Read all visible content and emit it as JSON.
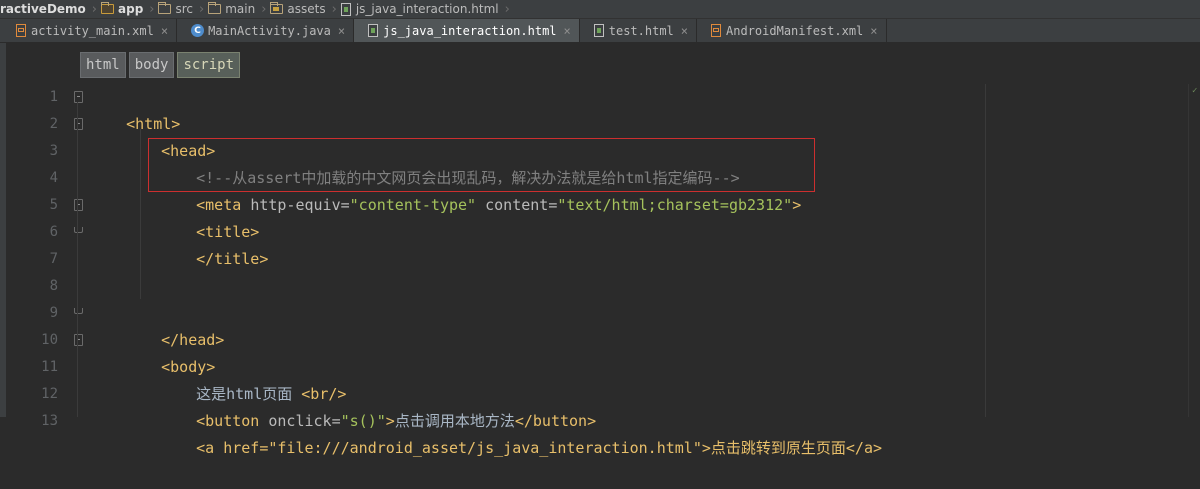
{
  "breadcrumbs": [
    {
      "label": "ractiveDemo",
      "icon": "module-folder-icon"
    },
    {
      "label": "app",
      "icon": "module-folder-icon"
    },
    {
      "label": "src",
      "icon": "folder-icon"
    },
    {
      "label": "main",
      "icon": "folder-icon"
    },
    {
      "label": "assets",
      "icon": "resources-folder-icon"
    },
    {
      "label": "js_java_interaction.html",
      "icon": "html-file-icon"
    }
  ],
  "tabs": [
    {
      "label": "activity_main.xml",
      "icon": "xml-file-icon",
      "active": false
    },
    {
      "label": "MainActivity.java",
      "icon": "java-class-icon",
      "active": false
    },
    {
      "label": "js_java_interaction.html",
      "icon": "html-file-icon",
      "active": true
    },
    {
      "label": "test.html",
      "icon": "html-file-icon",
      "active": false
    },
    {
      "label": "AndroidManifest.xml",
      "icon": "xml-file-icon",
      "active": false
    }
  ],
  "tab_close_glyph": "×",
  "tag_path": [
    "html",
    "body",
    "script"
  ],
  "editor": {
    "line_numbers": [
      "1",
      "2",
      "3",
      "4",
      "5",
      "6",
      "7",
      "8",
      "9",
      "10",
      "11",
      "12",
      "13"
    ],
    "lines": {
      "l1": "<html>",
      "l2": "<head>",
      "l3": "<!--从assert中加载的中文网页会出现乱码，解决办法就是给html指定编码-->",
      "l4a": "<meta ",
      "l4b": "http-equiv=",
      "l4c": "\"content-type\"",
      "l4d": " content=",
      "l4e": "\"text/html;charset=gb2312\"",
      "l4f": ">",
      "l5": "<title>",
      "l6": "</title>",
      "l9": "</head>",
      "l10": "<body>",
      "l11a": "这是html页面 ",
      "l11b": "<br/>",
      "l12a": "<button ",
      "l12b": "onclick=",
      "l12c": "\"s()\"",
      "l12d": ">",
      "l12e": "点击调用本地方法",
      "l12f": "</button>",
      "l13": "<a href=\"file:///android_asset/js_java_interaction.html\">点击跳转到原生页面</a>"
    }
  },
  "colors": {
    "background": "#2b2b2b",
    "tag": "#e8bf6a",
    "attribute_value": "#a5c25c",
    "comment": "#808080",
    "highlight_box": "#cc2f2f"
  }
}
